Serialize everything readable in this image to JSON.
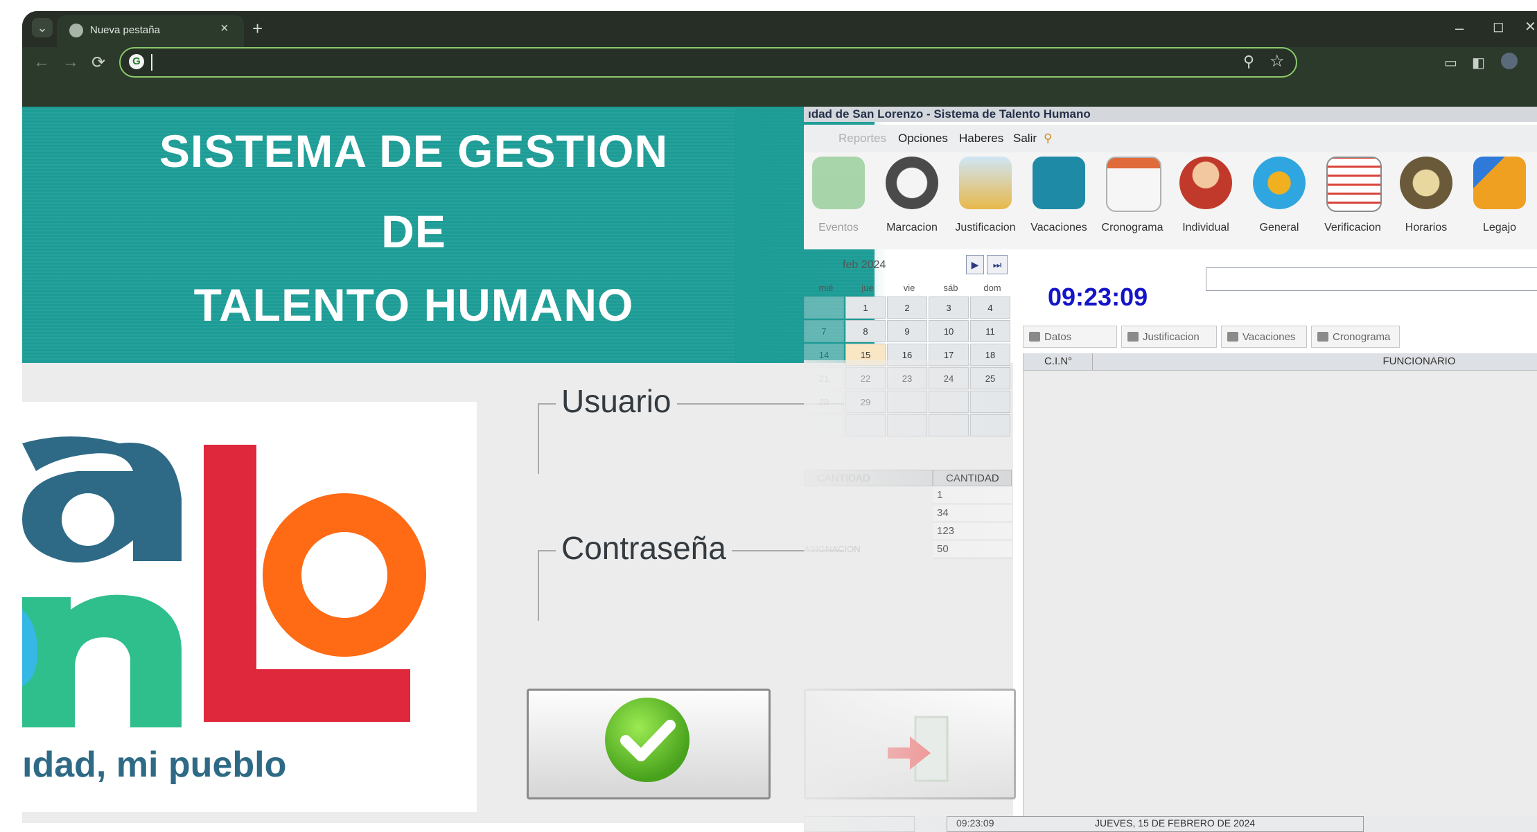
{
  "browser": {
    "tab_title": "Nueva pestaña",
    "tab_list_icon": "chevron-down-icon",
    "new_tab_label": "+",
    "window_min": "–",
    "window_max": "◻",
    "window_close": "✕",
    "address_value": "",
    "address_placeholder": "",
    "back_icon": "←",
    "forward_icon": "→",
    "reload_icon": "⟳",
    "zoom_icon": "⚲",
    "bookmark_icon": "☆"
  },
  "login": {
    "title_line1": "SISTEMA DE GESTION",
    "title_line2": "DE",
    "title_line3": "TALENTO HUMANO",
    "slogan": "ıdad, mi pueblo",
    "user_label": "Usuario",
    "user_value": "",
    "password_label": "Contraseña",
    "password_value": "",
    "colors": {
      "teal": "#1d9c96",
      "logo_blue": "#2e6a86",
      "logo_green": "#2fbf8c",
      "logo_red": "#e0283c",
      "logo_orange": "#ff6a14",
      "ok_green": "#48a21c"
    }
  },
  "app": {
    "title": "ıdad de San Lorenzo - Sistema de Talento Humano",
    "menu": [
      "Reportes",
      "Opciones",
      "Haberes",
      "Salir"
    ],
    "menu_search_icon": "🔍",
    "toolbar": [
      {
        "label": "Eventos",
        "icon": "events-icon",
        "color": "#4caf50"
      },
      {
        "label": "Marcacion",
        "icon": "clock-icon",
        "color": "#5a5a5a"
      },
      {
        "label": "Justificacion",
        "icon": "justification-icon",
        "color": "#e8b84a"
      },
      {
        "label": "Vacaciones",
        "icon": "suitcase-icon",
        "color": "#1e8aa6"
      },
      {
        "label": "Cronograma",
        "icon": "calendar-icon",
        "color": "#e06a3a"
      },
      {
        "label": "Individual",
        "icon": "person-icon",
        "color": "#c0392b"
      },
      {
        "label": "General",
        "icon": "globe-icon",
        "color": "#2fa6e0"
      },
      {
        "label": "Verificacion",
        "icon": "checklist-icon",
        "color": "#d9443a"
      },
      {
        "label": "Horarios",
        "icon": "schedule-icon",
        "color": "#6a5a3a"
      },
      {
        "label": "Legajo",
        "icon": "folder-icon",
        "color": "#f0a020"
      }
    ],
    "calendar": {
      "month": "feb 2024",
      "next_icon": "▶",
      "last_icon": "⏭",
      "dow": [
        "mié",
        "jue",
        "vie",
        "sáb",
        "dom"
      ],
      "rows": [
        [
          "",
          "1",
          "2",
          "3",
          "4"
        ],
        [
          "7",
          "8",
          "9",
          "10",
          "11"
        ],
        [
          "14",
          "15",
          "16",
          "17",
          "18"
        ],
        [
          "21",
          "22",
          "23",
          "24",
          "25"
        ],
        [
          "28",
          "29",
          "",
          "",
          ""
        ],
        [
          "",
          "",
          "",
          "",
          ""
        ]
      ]
    },
    "qty_table": {
      "head_left": "CANTIDAD",
      "head_right": "CANTIDAD",
      "rows": [
        {
          "label": "",
          "value": "1"
        },
        {
          "label": "",
          "value": "34"
        },
        {
          "label": "",
          "value": "123"
        },
        {
          "label": "ASIGNACION",
          "value": "50"
        }
      ]
    },
    "clock": "09:23:09",
    "search_value": "",
    "subtabs": [
      "Datos",
      "Justificacion",
      "Vacaciones",
      "Cronograma"
    ],
    "grid_columns": [
      "C.I.N°",
      "FUNCIONARIO"
    ],
    "status_time": "09:23:09",
    "status_date": "JUEVES, 15 DE FEBRERO DE 2024"
  }
}
